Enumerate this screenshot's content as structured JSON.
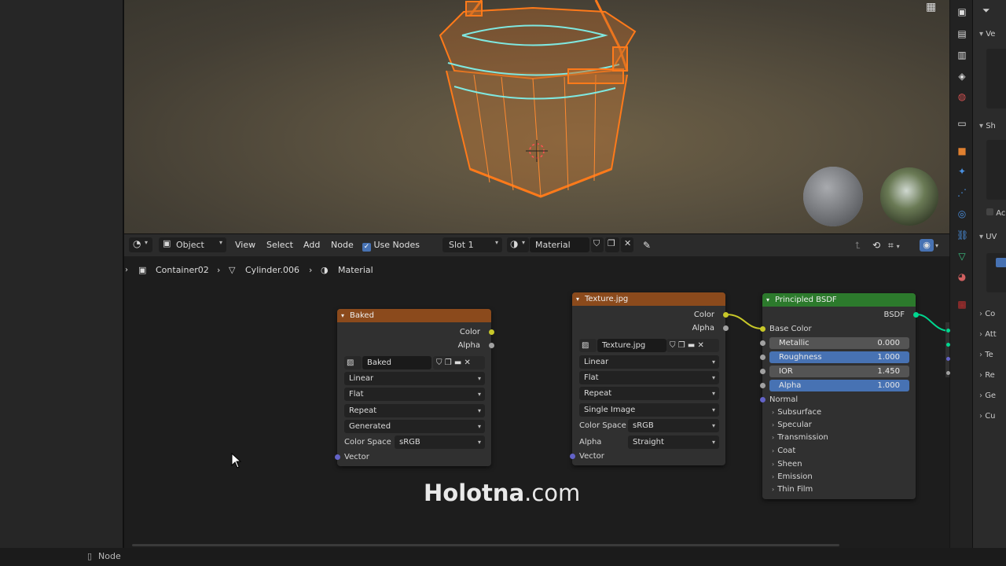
{
  "header": {
    "editor_type_icon": "node-editor-icon",
    "mode_select": "Object",
    "menu": [
      "View",
      "Select",
      "Add",
      "Node"
    ],
    "use_nodes_label": "Use Nodes",
    "use_nodes_checked": true,
    "slot_select": "Slot 1",
    "material_name": "Material"
  },
  "breadcrumb": {
    "object": "Container02",
    "mesh": "Cylinder.006",
    "material": "Material"
  },
  "nodes": {
    "baked": {
      "title": "Baked",
      "outputs": [
        "Color",
        "Alpha"
      ],
      "image_name": "Baked",
      "interpolation": "Linear",
      "projection": "Flat",
      "extension": "Repeat",
      "source": "Generated",
      "color_space_label": "Color Space",
      "color_space": "sRGB",
      "input": "Vector"
    },
    "texture": {
      "title": "Texture.jpg",
      "outputs": [
        "Color",
        "Alpha"
      ],
      "image_name": "Texture.jpg",
      "interpolation": "Linear",
      "projection": "Flat",
      "extension": "Repeat",
      "source": "Single Image",
      "color_space_label": "Color Space",
      "color_space": "sRGB",
      "alpha_label": "Alpha",
      "alpha_mode": "Straight",
      "input": "Vector"
    },
    "principled": {
      "title": "Principled BSDF",
      "output": "BSDF",
      "base_color": "Base Color",
      "metallic": {
        "label": "Metallic",
        "value": "0.000"
      },
      "roughness": {
        "label": "Roughness",
        "value": "1.000"
      },
      "ior": {
        "label": "IOR",
        "value": "1.450"
      },
      "alpha": {
        "label": "Alpha",
        "value": "1.000"
      },
      "normal": "Normal",
      "panels": [
        "Subsurface",
        "Specular",
        "Transmission",
        "Coat",
        "Sheen",
        "Emission",
        "Thin Film"
      ]
    }
  },
  "props_panel": {
    "items": [
      "Ve",
      "Sh",
      "Ac",
      "UV",
      "Co",
      "Att",
      "Te",
      "Re",
      "Ge",
      "Cu"
    ]
  },
  "status_bar": {
    "mouse_hint": "Node"
  },
  "watermark": {
    "brand": "Holotna",
    "suffix": ".com"
  },
  "colors": {
    "image_node_header": "#8b4a1c",
    "shader_node_header": "#2c7a2c",
    "selection_orange": "#ff7a1a",
    "slider_blue": "#4772b3"
  }
}
